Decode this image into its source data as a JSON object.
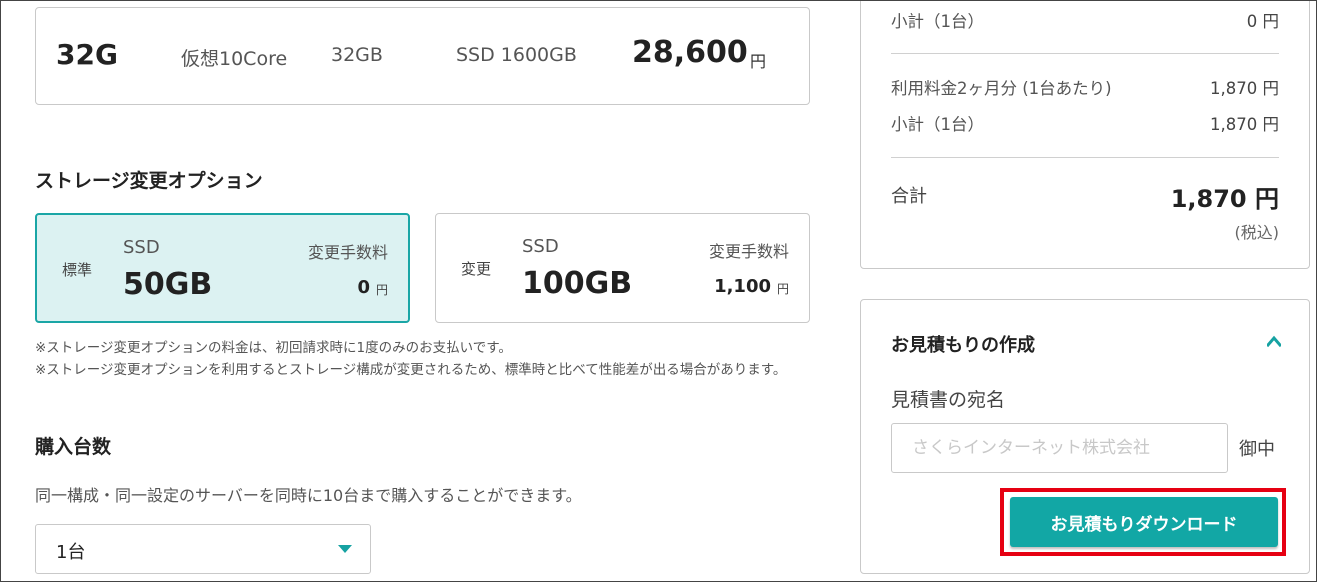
{
  "plan": {
    "name": "32G",
    "cpu": "仮想10Core",
    "memory": "32GB",
    "disk": "SSD 1600GB",
    "price": "28,600",
    "yen": "円"
  },
  "storage": {
    "title": "ストレージ変更オプション",
    "options": [
      {
        "label": "標準",
        "type": "SSD",
        "size": "50GB",
        "fee_label": "変更手数料",
        "fee": "0",
        "yen": "円"
      },
      {
        "label": "変更",
        "type": "SSD",
        "size": "100GB",
        "fee_label": "変更手数料",
        "fee": "1,100",
        "yen": "円"
      }
    ],
    "note1": "※ストレージ変更オプションの料金は、初回請求時に1度のみのお支払いです。",
    "note2": "※ストレージ変更オプションを利用するとストレージ構成が変更されるため、標準時と比べて性能差が出る場合があります。"
  },
  "quantity": {
    "title": "購入台数",
    "description": "同一構成・同一設定のサーバーを同時に10台まで購入することができます。",
    "selected": "1台"
  },
  "summary": {
    "subtotal1_label": "小計（1台）",
    "subtotal1_value": "0 円",
    "usage_label": "利用料金2ヶ月分 (1台あたり)",
    "usage_value": "1,870 円",
    "subtotal2_label": "小計（1台）",
    "subtotal2_value": "1,870 円",
    "total_label": "合計",
    "total_value": "1,870 円",
    "tax_note": "(税込)"
  },
  "quote": {
    "title": "お見積もりの作成",
    "address_label": "見積書の宛名",
    "address_placeholder": "さくらインターネット株式会社",
    "honorific": "御中",
    "download_label": "お見積もりダウンロード"
  },
  "colors": {
    "accent": "#12a7a5",
    "selected_bg": "#dcf2f2",
    "highlight": "#e60012"
  }
}
